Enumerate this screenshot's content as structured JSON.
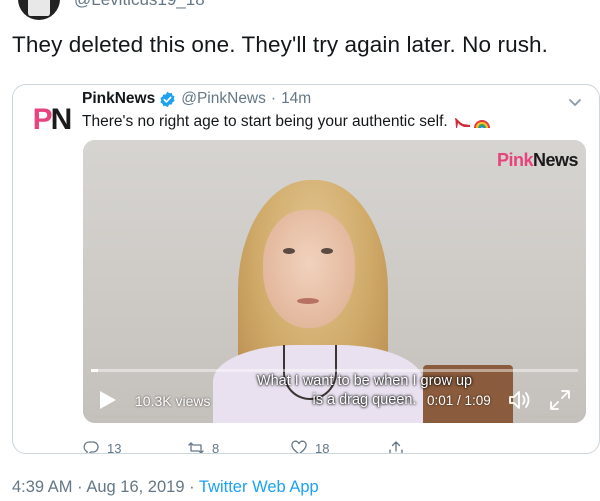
{
  "top": {
    "handle_cut": "@Leviticus19_18"
  },
  "tweet": {
    "text": "They deleted this one. They'll try again later. No rush."
  },
  "quoted": {
    "logo_p": "P",
    "logo_n": "N",
    "name": "PinkNews",
    "handle": "@PinkNews",
    "separator": "·",
    "time": "14m",
    "text": "There's no right age to start being your authentic self.",
    "emojis": [
      "high-heel-icon",
      "rainbow-icon"
    ]
  },
  "video": {
    "watermark_pink": "Pink",
    "watermark_dark": "News",
    "subtitle_line1": "What I want to be when I grow up",
    "subtitle_line2": "is a drag queen.",
    "views": "10.3K views",
    "timer": "0:01 / 1:09",
    "progress_fraction": 0.01
  },
  "actions": {
    "replies": "13",
    "retweets": "8",
    "likes": "18"
  },
  "meta": {
    "time": "4:39 AM",
    "separator1": "·",
    "date": "Aug 16, 2019",
    "separator2": "·",
    "source": "Twitter Web App"
  },
  "colors": {
    "verified": "#1da1f2",
    "pink": "#e5447d",
    "link": "#1da1f2",
    "muted": "#657786"
  }
}
